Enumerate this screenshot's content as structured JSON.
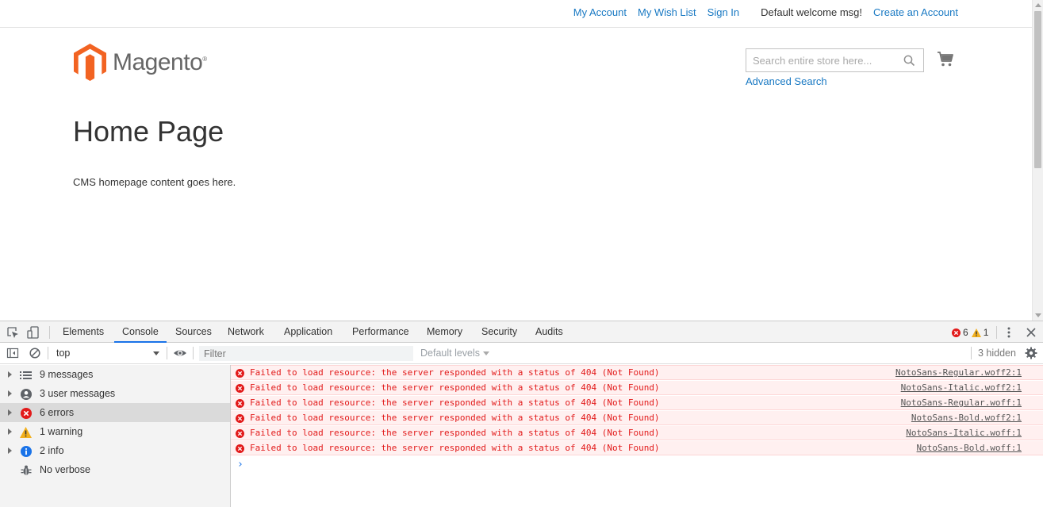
{
  "header": {
    "links": {
      "my_account": "My Account",
      "my_wish_list": "My Wish List",
      "sign_in": "Sign In",
      "welcome": "Default welcome msg!",
      "create_account": "Create an Account"
    },
    "logo_text": "Magento",
    "logo_reg": "®",
    "search_placeholder": "Search entire store here...",
    "advanced_search": "Advanced Search"
  },
  "main": {
    "title": "Home Page",
    "content": "CMS homepage content goes here."
  },
  "devtools": {
    "tabs": [
      {
        "label": "Elements"
      },
      {
        "label": "Console"
      },
      {
        "label": "Sources"
      },
      {
        "label": "Network"
      },
      {
        "label": "Application"
      },
      {
        "label": "Performance"
      },
      {
        "label": "Memory"
      },
      {
        "label": "Security"
      },
      {
        "label": "Audits"
      }
    ],
    "active_tab": "Console",
    "error_count": "6",
    "warning_count": "1",
    "context": "top",
    "filter_placeholder": "Filter",
    "levels": "Default levels",
    "hidden": "3 hidden",
    "sidebar": [
      {
        "label": "9 messages",
        "icon": "list-icon"
      },
      {
        "label": "3 user messages",
        "icon": "user-icon"
      },
      {
        "label": "6 errors",
        "icon": "error-icon"
      },
      {
        "label": "1 warning",
        "icon": "warning-icon"
      },
      {
        "label": "2 info",
        "icon": "info-icon"
      },
      {
        "label": "No verbose",
        "icon": "bug-icon"
      }
    ],
    "messages": [
      {
        "text": "Failed to load resource: the server responded with a status of 404 (Not Found)",
        "source": "NotoSans-Regular.woff2:1"
      },
      {
        "text": "Failed to load resource: the server responded with a status of 404 (Not Found)",
        "source": "NotoSans-Italic.woff2:1"
      },
      {
        "text": "Failed to load resource: the server responded with a status of 404 (Not Found)",
        "source": "NotoSans-Regular.woff:1"
      },
      {
        "text": "Failed to load resource: the server responded with a status of 404 (Not Found)",
        "source": "NotoSans-Bold.woff2:1"
      },
      {
        "text": "Failed to load resource: the server responded with a status of 404 (Not Found)",
        "source": "NotoSans-Italic.woff:1"
      },
      {
        "text": "Failed to load resource: the server responded with a status of 404 (Not Found)",
        "source": "NotoSans-Bold.woff:1"
      }
    ]
  },
  "colors": {
    "link": "#1979c3",
    "brand_orange": "#f26322",
    "error_red": "#e21a1a",
    "devtools_blue": "#1a73e8"
  }
}
